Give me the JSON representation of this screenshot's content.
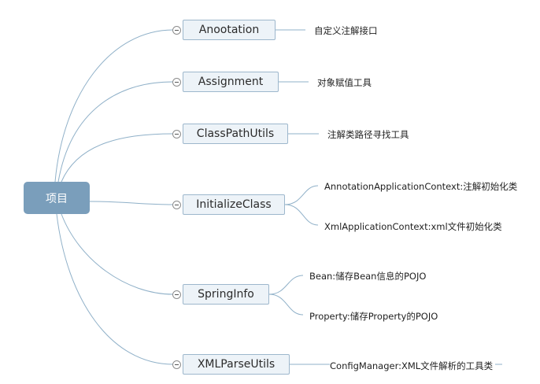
{
  "root": {
    "label": "项目"
  },
  "branches": [
    {
      "label": "Anootation",
      "children": [
        "自定义注解接口"
      ]
    },
    {
      "label": "Assignment",
      "children": [
        "对象赋值工具"
      ]
    },
    {
      "label": "ClassPathUtils",
      "children": [
        "注解类路径寻找工具"
      ]
    },
    {
      "label": "InitializeClass",
      "children": [
        "AnnotationApplicationContext:注解初始化类",
        "XmlApplicationContext:xml文件初始化类"
      ]
    },
    {
      "label": "SpringInfo",
      "children": [
        "Bean:储存Bean信息的POJO",
        "Property:储存Property的POJO"
      ]
    },
    {
      "label": "XMLParseUtils",
      "children": [
        "ConfigManager:XML文件解析的工具类"
      ]
    }
  ],
  "colors": {
    "root": "#7a9ebb",
    "branch_fill": "#edf3f8",
    "branch_border": "#9db7cc",
    "line": "#8fb0c8"
  }
}
